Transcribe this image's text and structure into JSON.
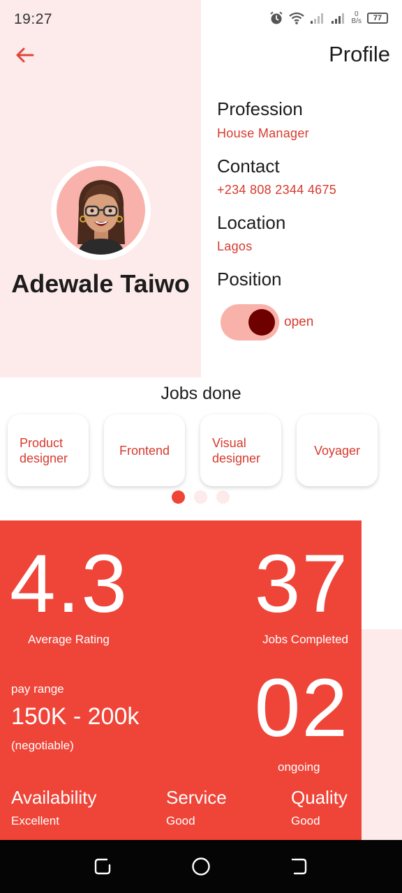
{
  "status_bar": {
    "time": "19:27",
    "net_speed_top": "0",
    "net_speed_bottom": "B/s",
    "battery": "77"
  },
  "header": {
    "title": "Profile",
    "back_icon": "arrow-left-icon"
  },
  "profile": {
    "name": "Adewale Taiwo",
    "avatar": "memoji-avatar"
  },
  "info": [
    {
      "label": "Profession",
      "value": "House Manager"
    },
    {
      "label": "Contact",
      "value": "+234 808 2344 4675"
    },
    {
      "label": "Location",
      "value": "Lagos"
    },
    {
      "label": "Position",
      "value": ""
    }
  ],
  "position_toggle": {
    "label": "open",
    "on": true
  },
  "jobs": {
    "title": "Jobs done",
    "items": [
      {
        "line1": "Product",
        "line2": "designer"
      },
      {
        "line1": "Frontend",
        "line2": ""
      },
      {
        "line1": "Visual",
        "line2": "designer"
      },
      {
        "line1": "Voyager",
        "line2": ""
      }
    ],
    "pager": {
      "count": 3,
      "active": 0
    }
  },
  "stats": {
    "rating": {
      "value": "4.3",
      "caption": "Average Rating"
    },
    "completed": {
      "value": "37",
      "caption": "Jobs Completed"
    },
    "pay": {
      "label": "pay range",
      "value": "150K - 200k",
      "note": "(negotiable)"
    },
    "ongoing": {
      "value": "02",
      "caption": "ongoing"
    },
    "qualities": [
      {
        "label": "Availability",
        "value": "Excellent"
      },
      {
        "label": "Service",
        "value": "Good"
      },
      {
        "label": "Quality",
        "value": "Good"
      }
    ]
  },
  "colors": {
    "accent": "#ef4438",
    "accent_text": "#d63a2e",
    "panel_pink": "#fdeaea",
    "toggle_knob": "#6e0000"
  }
}
